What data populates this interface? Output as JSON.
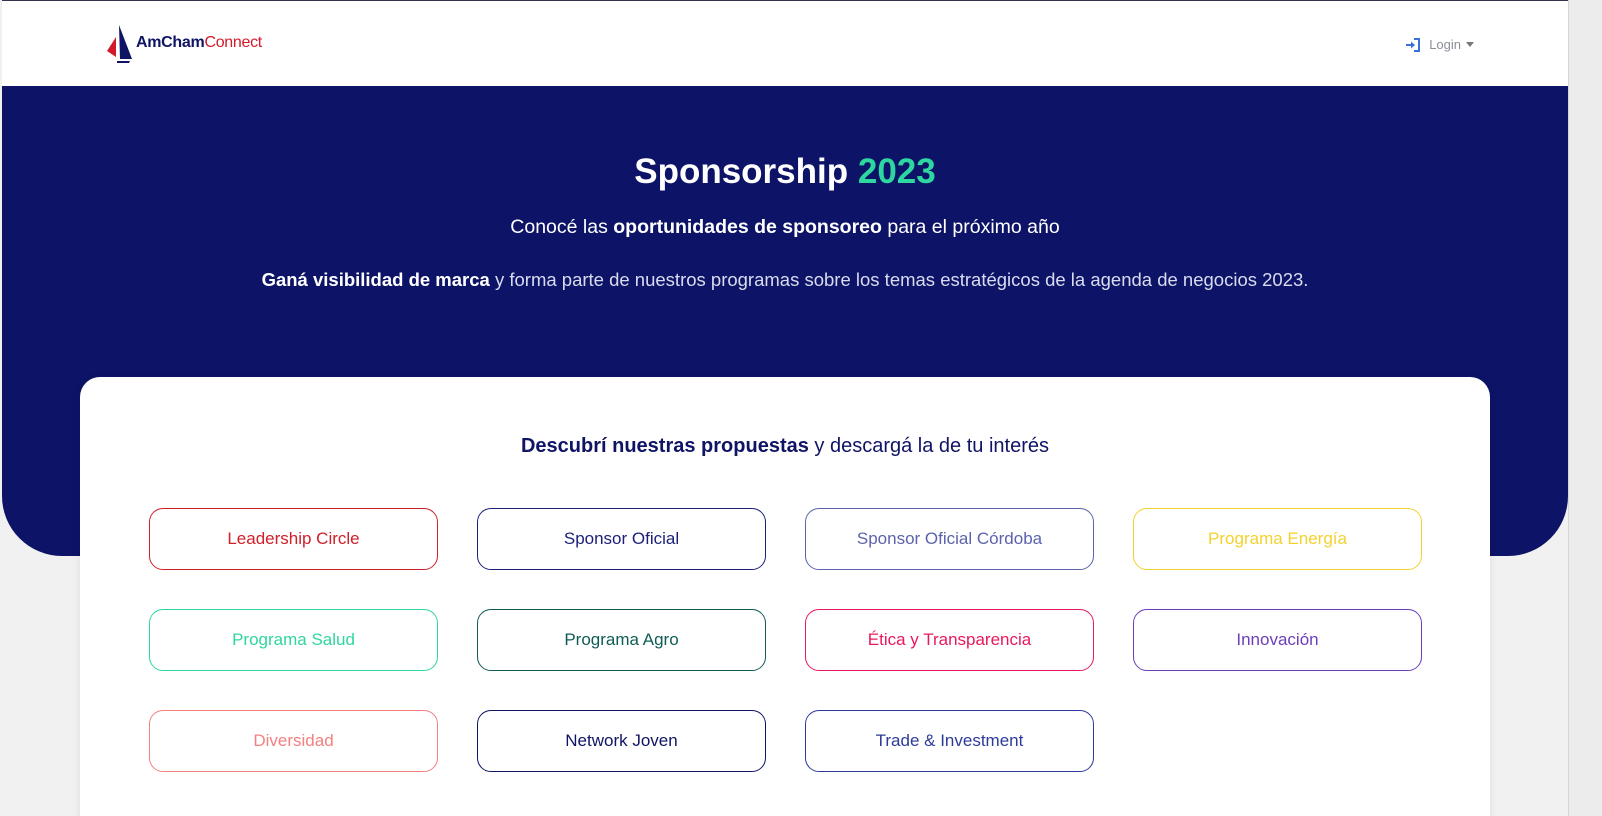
{
  "nav": {
    "logo_part1": "AmCham",
    "logo_part2": "Connect",
    "login_label": "Login"
  },
  "hero": {
    "title_main": "Sponsorship",
    "title_year": "2023",
    "subtitle_pre": "Conocé las ",
    "subtitle_bold": "oportunidades de sponsoreo",
    "subtitle_post": " para el próximo año",
    "desc_bold": "Ganá visibilidad de marca",
    "desc_rest": " y forma parte de nuestros programas sobre los temas estratégicos de la agenda de negocios 2023."
  },
  "proposals": {
    "heading_bold": "Descubrí nuestras propuestas",
    "heading_rest": " y descargá la de tu interés",
    "items": [
      {
        "label": "Leadership Circle",
        "color": "#d0202a"
      },
      {
        "label": "Sponsor Oficial",
        "color": "#1a1f78"
      },
      {
        "label": "Sponsor Oficial Córdoba",
        "color": "#5b63ad"
      },
      {
        "label": "Programa Energía",
        "color": "#f2d230"
      },
      {
        "label": "Programa Salud",
        "color": "#2fd6a1"
      },
      {
        "label": "Programa Agro",
        "color": "#0f5c55"
      },
      {
        "label": "Ética y Transparencia",
        "color": "#e8195a"
      },
      {
        "label": "Innovación",
        "color": "#6a3fb8"
      },
      {
        "label": "Diversidad",
        "color": "#f48080"
      },
      {
        "label": "Network Joven",
        "color": "#0f1464"
      },
      {
        "label": "Trade & Investment",
        "color": "#2d3a9a"
      }
    ]
  }
}
